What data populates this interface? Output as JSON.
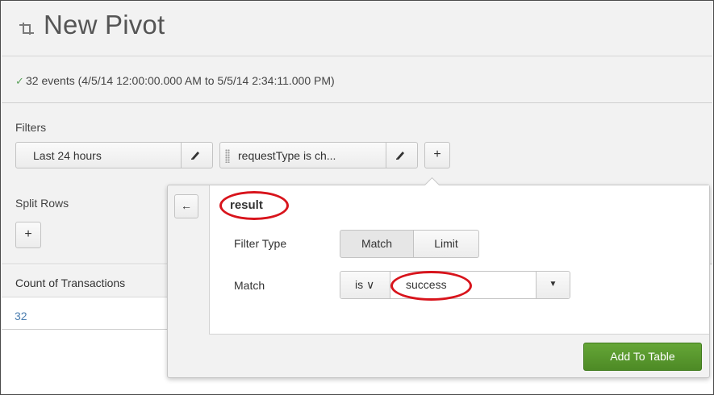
{
  "header": {
    "title": "New Pivot",
    "status_text": "32 events (4/5/14 12:00:00.000 AM to 5/5/14 2:34:11.000 PM)",
    "status_icon": "check-icon",
    "status_color": "#5ba25b"
  },
  "filters": {
    "label": "Filters",
    "time_filter_label": "Last 24 hours",
    "request_filter_label": "requestType is ch...",
    "add_label": "+"
  },
  "split_rows": {
    "label": "Split Rows",
    "add_label": "+"
  },
  "table": {
    "column_header": "Count of Transactions",
    "rows": [
      "32"
    ]
  },
  "popover": {
    "back_label": "←",
    "field_name": "result",
    "filter_type_label": "Filter Type",
    "filter_type_options": [
      "Match",
      "Limit"
    ],
    "filter_type_selected": "Match",
    "match_label": "Match",
    "operator": "is ∨",
    "match_value": "success",
    "caret": "▼",
    "add_button_label": "Add To Table",
    "add_button_color": "#5a9a2e",
    "annotation_color": "#d8141c"
  }
}
